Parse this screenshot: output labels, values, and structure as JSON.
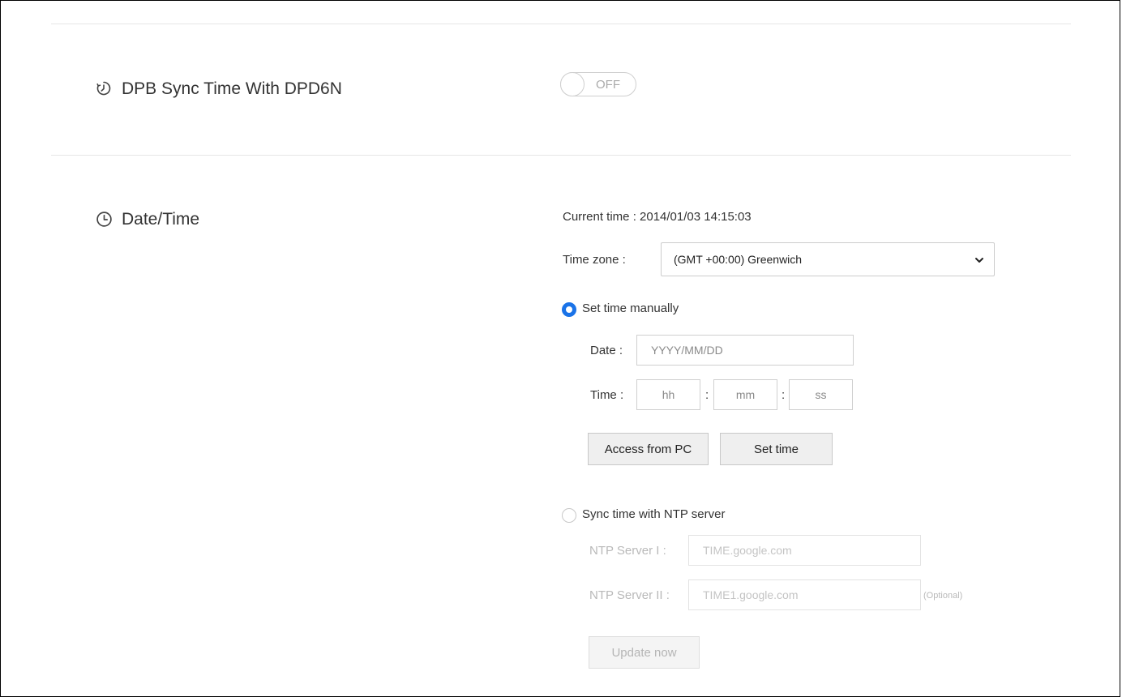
{
  "sync": {
    "title": "DPB Sync Time With DPD6N",
    "icon": "timer-icon",
    "toggle_label": "OFF"
  },
  "datetime": {
    "title": "Date/Time",
    "icon": "clock-icon",
    "current_time_label": "Current time : 2014/01/03 14:15:03",
    "timezone_label": "Time zone :",
    "timezone_value": "(GMT +00:00) Greenwich",
    "manual": {
      "label": "Set time manually",
      "selected": true,
      "date_label": "Date :",
      "date_placeholder": "YYYY/MM/DD",
      "time_label": "Time :",
      "hh_placeholder": "hh",
      "mm_placeholder": "mm",
      "ss_placeholder": "ss",
      "sep": ":",
      "access_button": "Access from PC",
      "set_button": "Set time"
    },
    "ntp": {
      "label": "Sync time with NTP server",
      "selected": false,
      "server1_label": "NTP Server I :",
      "server1_value": "TIME.google.com",
      "server2_label": "NTP Server II :",
      "server2_value": "TIME1.google.com",
      "optional_label": "(Optional)",
      "update_button": "Update now"
    }
  },
  "colors": {
    "accent": "#1a73e8",
    "divider": "#e6e6e6",
    "disabled_text": "#b9b9b9"
  }
}
